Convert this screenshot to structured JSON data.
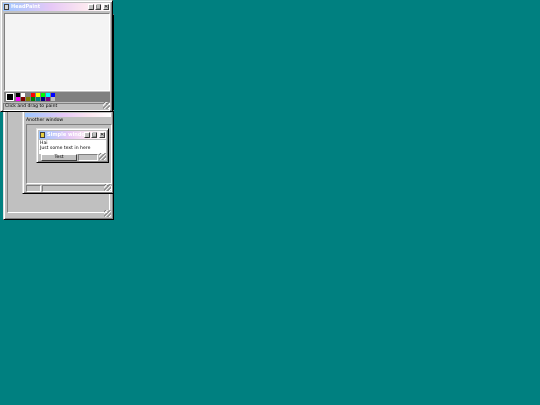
{
  "desktop": {
    "background": "#008080"
  },
  "windows": {
    "paint": {
      "title": "HeadPaint",
      "icon": "paint-app-icon",
      "buttons": {
        "minimize": "_",
        "maximize": "□",
        "close": "✕"
      },
      "palette": [
        "#000000",
        "#ffffff",
        "#808080",
        "#ff0000",
        "#ffff00",
        "#00ff00",
        "#00ffff",
        "#0000ff",
        "#ff00ff",
        "#800000",
        "#808000",
        "#008000",
        "#008080",
        "#000080",
        "#800080",
        "#c0c0c0"
      ],
      "status": "Click and drag to paint"
    },
    "another": {
      "label": "Another window"
    },
    "simple": {
      "title": "Simple window",
      "icon": "folder-icon",
      "buttons": {
        "minimize": "_",
        "maximize": "□",
        "close": "✕"
      },
      "text_line1": "Hai",
      "text_line2": "Just some text in here",
      "button_label": "Test"
    }
  }
}
